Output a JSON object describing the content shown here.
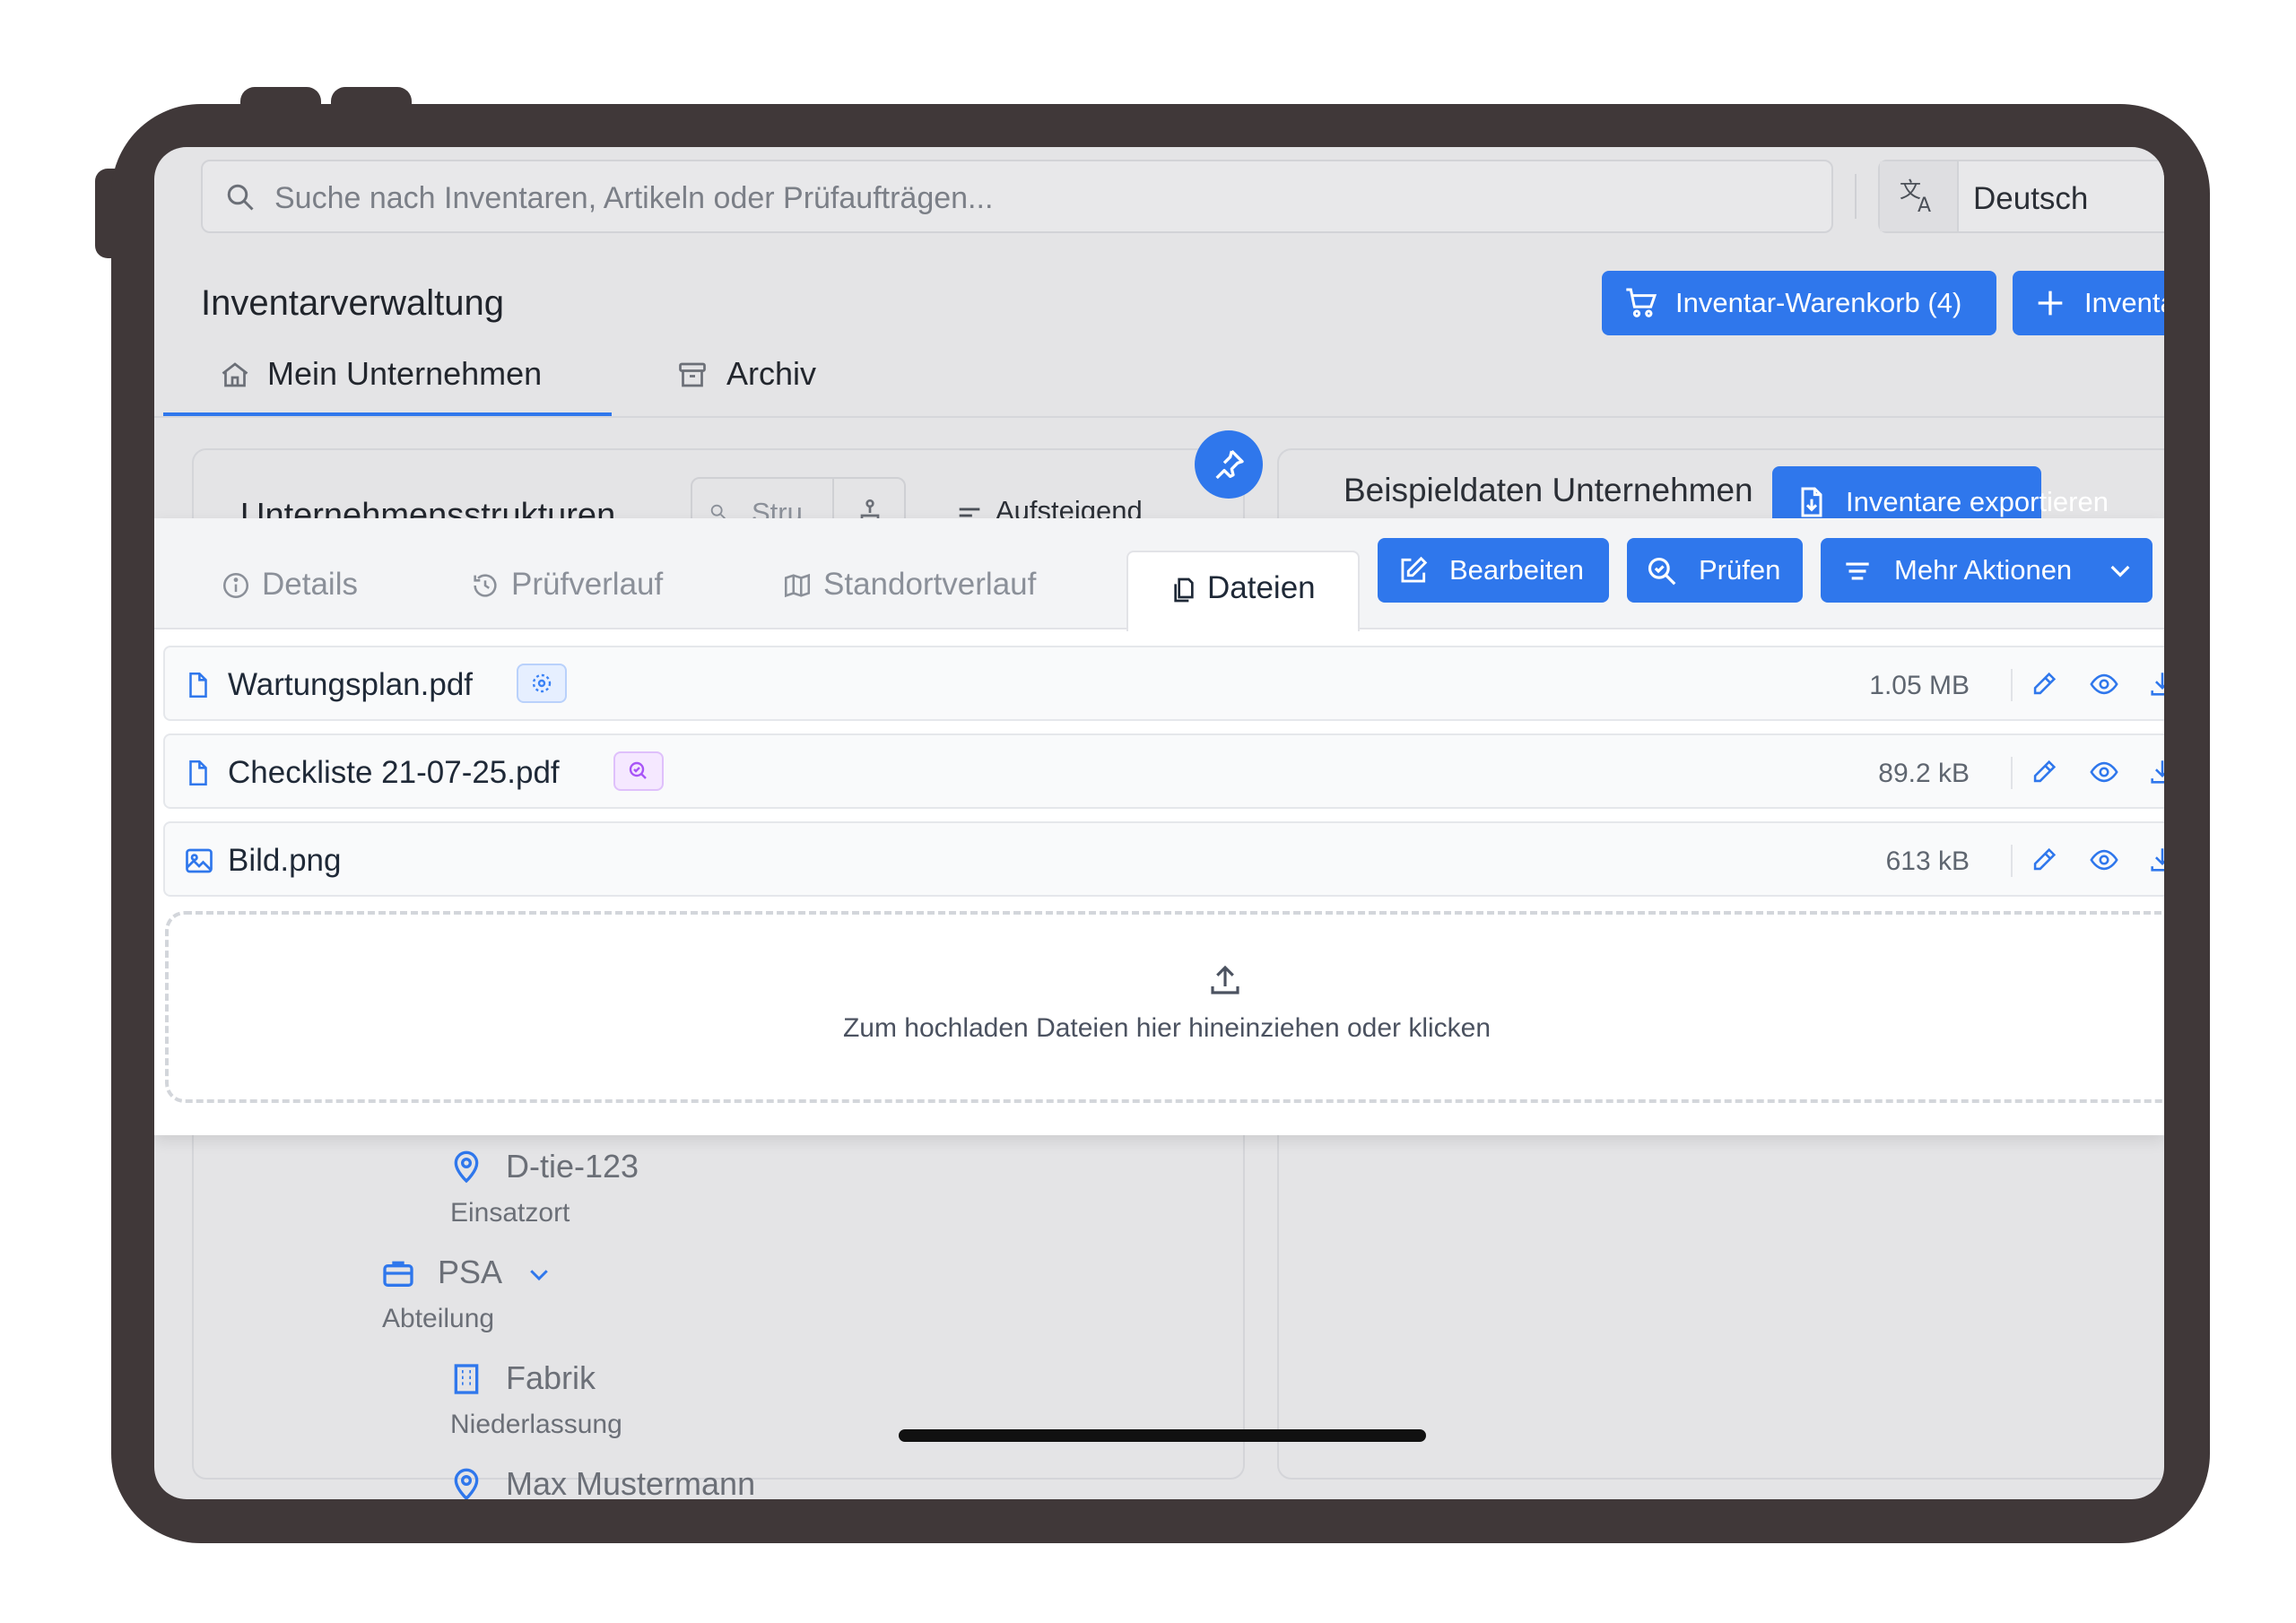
{
  "search": {
    "placeholder": "Suche nach Inventaren, Artikeln oder Prüfaufträgen..."
  },
  "language": {
    "label": "Deutsch"
  },
  "header": {
    "title": "Inventarverwaltung",
    "cart_button": "Inventar-Warenkorb (4)",
    "add_button": "Inventar"
  },
  "main_tabs": [
    {
      "label": "Mein Unternehmen",
      "active": true
    },
    {
      "label": "Archiv",
      "active": false
    }
  ],
  "left_card": {
    "title": "Unternehmensstrukturen",
    "segment_label": "Stru",
    "sort_label": "Aufsteigend"
  },
  "right_card": {
    "title": "Beispieldaten Unternehmen",
    "export_button": "Inventare exportieren"
  },
  "panel": {
    "tabs": [
      {
        "label": "Details",
        "icon": "info-icon"
      },
      {
        "label": "Prüfverlauf",
        "icon": "history-icon"
      },
      {
        "label": "Standortverlauf",
        "icon": "map-icon"
      },
      {
        "label": "Dateien",
        "icon": "files-icon",
        "active": true
      }
    ],
    "actions": {
      "edit": "Bearbeiten",
      "inspect": "Prüfen",
      "more": "Mehr Aktionen"
    },
    "files": [
      {
        "name": "Wartungsplan.pdf",
        "size": "1.05 MB",
        "icon": "file-icon",
        "badge": "maintenance-icon"
      },
      {
        "name": "Checkliste 21-07-25.pdf",
        "size": "89.2 kB",
        "icon": "file-icon",
        "badge": "inspection-icon"
      },
      {
        "name": "Bild.png",
        "size": "613 kB",
        "icon": "image-icon",
        "badge": null
      }
    ],
    "dropzone_text": "Zum hochladen Dateien hier hineinziehen oder klicken"
  },
  "tree": [
    {
      "name": "D-tie-123",
      "type": "Einsatzort",
      "icon": "location-pin-icon"
    },
    {
      "name": "PSA",
      "type": "Abteilung",
      "icon": "briefcase-icon"
    },
    {
      "name": "Fabrik",
      "type": "Niederlassung",
      "icon": "building-icon"
    },
    {
      "name": "Max Mustermann",
      "type": "",
      "icon": "location-pin-icon"
    }
  ],
  "colors": {
    "accent": "#2f77ec",
    "frame": "#403839",
    "maintenance_badge": "#3b82f6",
    "inspection_badge": "#a855f7"
  }
}
